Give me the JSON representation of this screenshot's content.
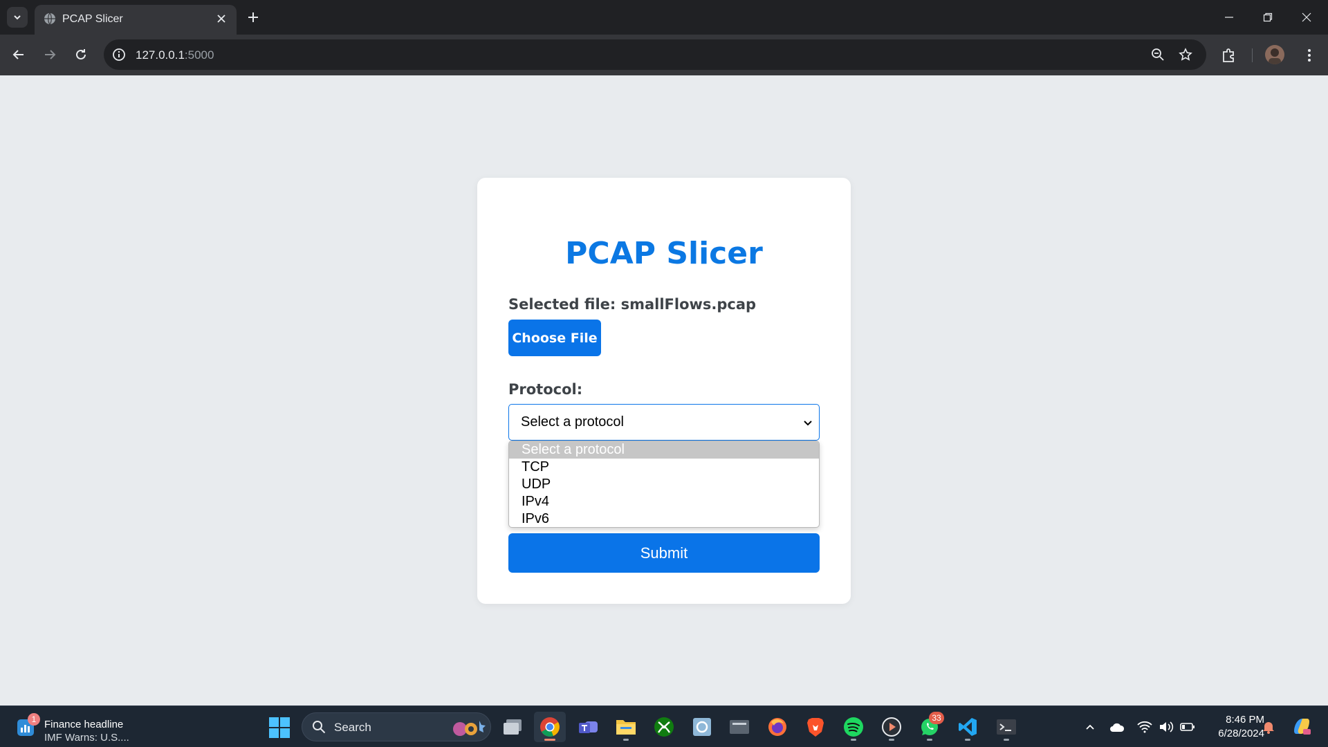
{
  "browser": {
    "tab": {
      "title": "PCAP Slicer"
    },
    "address": {
      "host": "127.0.0.1",
      "port": ":5000"
    }
  },
  "page": {
    "title": "PCAP Slicer",
    "selected_file_label": "Selected file: smallFlows.pcap",
    "choose_file_label": "Choose File",
    "protocol_label": "Protocol:",
    "protocol_select": {
      "value": "Select a protocol",
      "options": [
        "Select a protocol",
        "TCP",
        "UDP",
        "IPv4",
        "IPv6"
      ],
      "highlighted": "Select a protocol"
    },
    "submit_label": "Submit"
  },
  "taskbar": {
    "widget": {
      "badge": "1",
      "title": "Finance headline",
      "subtitle": "IMF Warns: U.S...."
    },
    "search_label": "Search",
    "whatsapp_badge": "33",
    "clock": {
      "time": "8:46 PM",
      "date": "6/28/2024"
    }
  },
  "colors": {
    "accent": "#0a74e8",
    "title": "#0b78e3",
    "page_bg": "#e8ebee",
    "taskbar_bg": "#1d2733"
  }
}
